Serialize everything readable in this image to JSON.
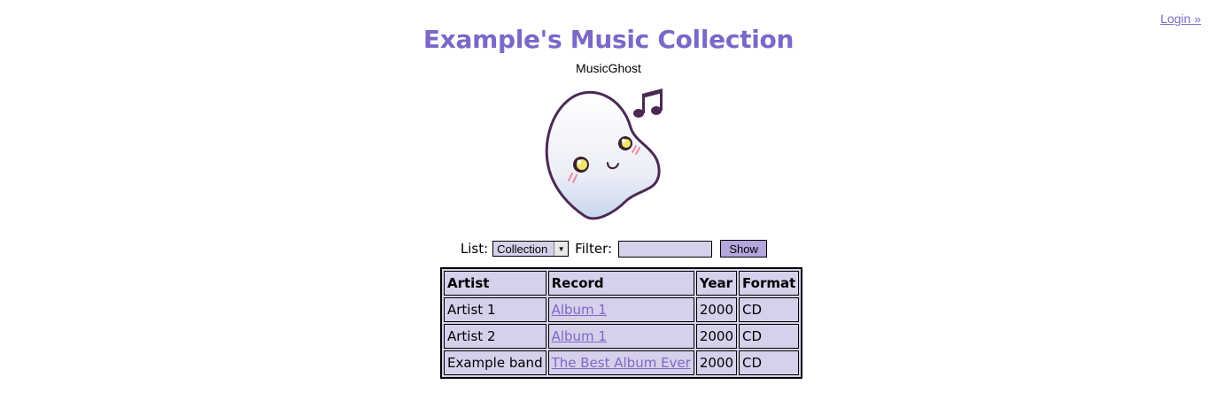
{
  "header": {
    "login_label": "Login »",
    "title": "Example's Music Collection",
    "subtitle": "MusicGhost"
  },
  "logo": {
    "icon": "music-ghost-mascot-icon",
    "colors": {
      "outline": "#4a2a55",
      "body": "#eef0f8",
      "blush": "#f08ca0"
    }
  },
  "controls": {
    "list_label": "List:",
    "list_selected": "Collection",
    "filter_label": "Filter:",
    "filter_value": "",
    "show_label": "Show"
  },
  "table": {
    "headers": [
      "Artist",
      "Record",
      "Year",
      "Format"
    ],
    "rows": [
      {
        "artist": "Artist 1",
        "record": "Album 1",
        "year": "2000",
        "format": "CD"
      },
      {
        "artist": "Artist 2",
        "record": "Album 1",
        "year": "2000",
        "format": "CD"
      },
      {
        "artist": "Example band",
        "record": "The Best Album Ever",
        "year": "2000",
        "format": "CD"
      }
    ]
  },
  "colors": {
    "accent": "#7b68c8",
    "panel": "#d6d0ea",
    "button": "#b2a6dc"
  }
}
